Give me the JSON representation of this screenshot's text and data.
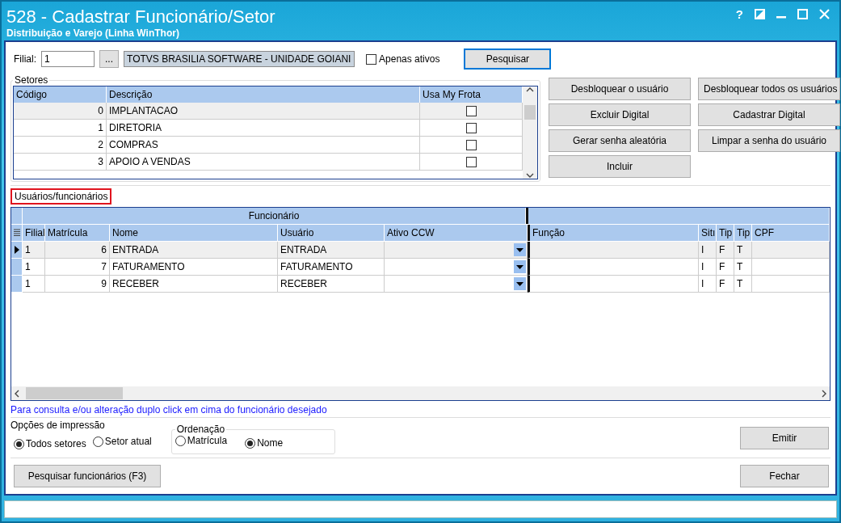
{
  "window": {
    "title": "528 - Cadastrar Funcionário/Setor",
    "subtitle": "Distribuição e Varejo (Linha WinThor)",
    "help": "?"
  },
  "filter": {
    "filial_label": "Filial:",
    "filial_value": "1",
    "lookup_button": "...",
    "filial_name": "TOTVS BRASILIA SOFTWARE - UNIDADE GOIANI",
    "active_only": {
      "label": "Apenas ativos",
      "checked": false
    },
    "search_button": "Pesquisar"
  },
  "setores": {
    "title": "Setores",
    "columns": [
      "Código",
      "Descrição",
      "Usa My Frota"
    ],
    "rows": [
      {
        "code": "0",
        "description": "IMPLANTACAO",
        "usa_my_frota": false,
        "selected": true
      },
      {
        "code": "1",
        "description": "DIRETORIA",
        "usa_my_frota": false,
        "selected": false
      },
      {
        "code": "2",
        "description": "COMPRAS",
        "usa_my_frota": false,
        "selected": false
      },
      {
        "code": "3",
        "description": "APOIO A VENDAS",
        "usa_my_frota": false,
        "selected": false
      }
    ]
  },
  "actions": [
    [
      "Desbloquear o usuário",
      "Desbloquear todos os usuários"
    ],
    [
      "Excluir Digital",
      "Cadastrar Digital"
    ],
    [
      "Gerar senha aleatória",
      "Limpar a senha do usuário"
    ],
    [
      "Incluir"
    ]
  ],
  "users": {
    "tab": "Usuários/funcionários",
    "group": "Funcionário",
    "columns": [
      "Filial",
      "Matrícula",
      "Nome",
      "Usuário",
      "Ativo CCW",
      "Função",
      "Sitı",
      "Tip",
      "Tip",
      "CPF"
    ],
    "rows": [
      {
        "filial": "1",
        "matricula": "6",
        "nome": "ENTRADA",
        "usuario": "ENTRADA",
        "situ": "I",
        "tip_1": "F",
        "tip_2": "T",
        "selected": true
      },
      {
        "filial": "1",
        "matricula": "7",
        "nome": "FATURAMENTO",
        "usuario": "FATURAMENTO",
        "situ": "I",
        "tip_1": "F",
        "tip_2": "T",
        "selected": false
      },
      {
        "filial": "1",
        "matricula": "9",
        "nome": "RECEBER",
        "usuario": "RECEBER",
        "situ": "I",
        "tip_1": "F",
        "tip_2": "T",
        "selected": false
      }
    ]
  },
  "hint": "Para consulta e/ou alteração duplo click em cima do funcionário desejado",
  "print_options": {
    "title": "Opções de impressão",
    "scope": [
      {
        "label": "Todos setores",
        "selected": true
      },
      {
        "label": "Setor atual",
        "selected": false
      }
    ],
    "ordering": {
      "title": "Ordenação",
      "options": [
        {
          "label": "Matrícula",
          "selected": false
        },
        {
          "label": "Nome",
          "selected": true
        }
      ]
    }
  },
  "buttons": {
    "emit": "Emitir",
    "search_employees": "Pesquisar funcionários (F3)",
    "close": "Fechar"
  }
}
